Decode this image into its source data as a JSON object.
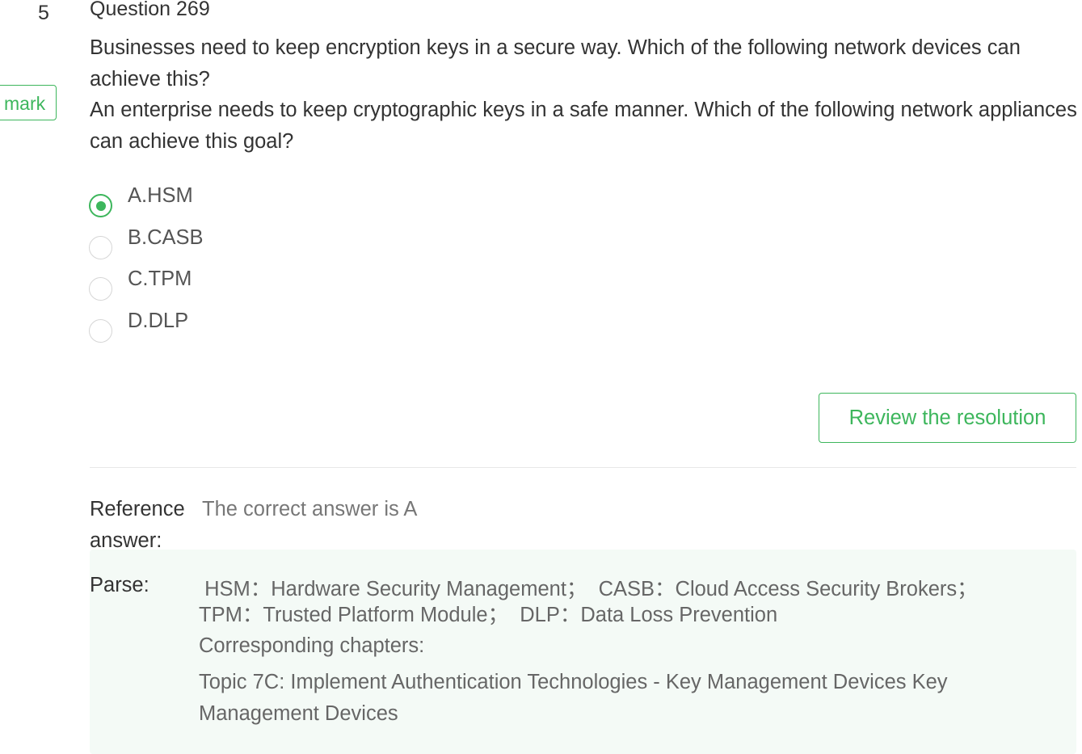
{
  "question": {
    "number": "5",
    "title": "Question 269",
    "mark_label": "mark",
    "text_line1": "Businesses need to keep encryption keys in a secure way. Which of the following network devices can achieve this?",
    "text_line2": "An enterprise needs to keep cryptographic keys in a safe manner. Which of the following network appliances can achieve this goal?"
  },
  "options": [
    {
      "label": "A.HSM",
      "selected": true
    },
    {
      "label": "B.CASB",
      "selected": false
    },
    {
      "label": "C.TPM",
      "selected": false
    },
    {
      "label": "D.DLP",
      "selected": false
    }
  ],
  "review_button_label": "Review the resolution",
  "reference": {
    "label": "Reference answer:",
    "value": "The correct answer is A"
  },
  "parse": {
    "label": "Parse:",
    "line1": " HSM：Hardware Security Management；  CASB：Cloud Access Security Brokers；",
    "line2": "TPM：Trusted Platform Module；  DLP：Data Loss Prevention",
    "line3": "Corresponding chapters:",
    "line4": "Topic 7C: Implement Authentication Technologies - Key Management Devices Key",
    "line5": "Management Devices"
  },
  "colors": {
    "accent": "#3db65c",
    "parse_bg": "#f4faf6",
    "divider": "#e8e8e8"
  }
}
